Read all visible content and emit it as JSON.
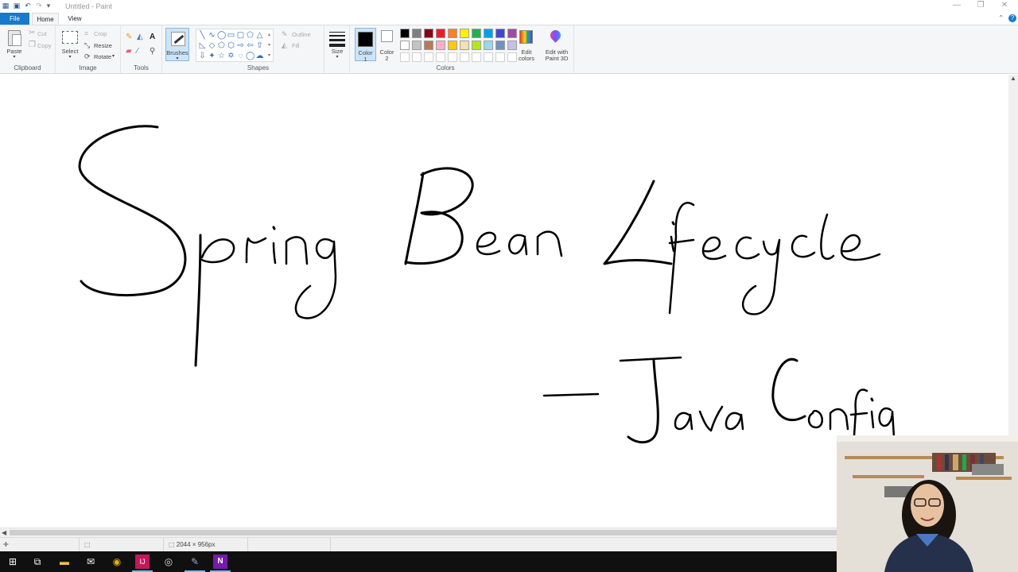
{
  "window": {
    "title": "Untitled - Paint",
    "controls": [
      "—",
      "❐",
      "✕"
    ]
  },
  "menu": {
    "file": "File",
    "home": "Home",
    "view": "View"
  },
  "ribbon": {
    "clipboard": {
      "group": "Clipboard",
      "paste": "Paste",
      "cut": "Cut",
      "copy": "Copy"
    },
    "image": {
      "group": "Image",
      "select": "Select",
      "crop": "Crop",
      "resize": "Resize",
      "rotate": "Rotate"
    },
    "tools": {
      "group": "Tools"
    },
    "brushes": {
      "label": "Brushes"
    },
    "shapes": {
      "group": "Shapes",
      "outline": "Outline",
      "fill": "Fill"
    },
    "size": {
      "label": "Size"
    },
    "color1": {
      "line1": "Color",
      "line2": "1"
    },
    "color2": {
      "line1": "Color",
      "line2": "2"
    },
    "colors": {
      "group": "Colors"
    },
    "edit_colors": {
      "line1": "Edit",
      "line2": "colors"
    },
    "edit_paint3d": {
      "line1": "Edit with",
      "line2": "Paint 3D"
    }
  },
  "palette_colors": [
    "#000000",
    "#7f7f7f",
    "#880015",
    "#ed1c24",
    "#ff7f27",
    "#fff200",
    "#22b14c",
    "#00a2e8",
    "#3f48cc",
    "#a349a4",
    "#ffffff",
    "#c3c3c3",
    "#b97a57",
    "#ffaec9",
    "#ffc90e",
    "#efe4b0",
    "#b5e61d",
    "#99d9ea",
    "#7092be",
    "#c8bfe7",
    "#ffffff",
    "#ffffff",
    "#ffffff",
    "#ffffff",
    "#ffffff",
    "#ffffff",
    "#ffffff",
    "#ffffff",
    "#ffffff",
    "#ffffff"
  ],
  "canvas": {
    "title_text": "Spring Bean Lifecycle",
    "subtitle_text": "— Java Config"
  },
  "status": {
    "dimensions": "2044 × 956px"
  },
  "taskbar_icons": [
    "windows-start-icon",
    "task-view-icon",
    "file-explorer-icon",
    "mail-icon",
    "chrome-icon",
    "intellij-icon",
    "obs-icon",
    "paint-icon",
    "onenote-icon"
  ]
}
